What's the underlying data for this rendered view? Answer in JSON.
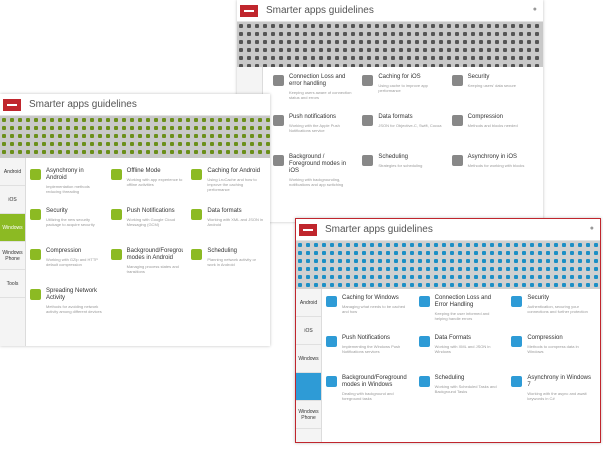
{
  "colors": {
    "brand": "#c0262d",
    "android": "#8cba23",
    "windows": "#2e9bd6",
    "ios": "#888888"
  },
  "windows": {
    "ios": {
      "title": "Smarter apps guidelines",
      "sidebar": [
        "",
        "",
        "",
        "",
        ""
      ],
      "cards": [
        {
          "title": "Connection Loss and error handling",
          "desc": "Keeping users aware of connection status and errors",
          "icon": "warning-icon"
        },
        {
          "title": "Caching for iOS",
          "desc": "Using cache to improve app performance",
          "icon": "cache-icon"
        },
        {
          "title": "Security",
          "desc": "Keeping users' data secure",
          "icon": "lock-icon"
        },
        {
          "title": "Push notifications",
          "desc": "Working with the Apple Push Notifications service",
          "icon": "bell-icon"
        },
        {
          "title": "Data formats",
          "desc": "JSON for Objective-C, Swift, Cocoa",
          "icon": "data-icon"
        },
        {
          "title": "Compression",
          "desc": "Methods and blocks needed",
          "icon": "compress-icon"
        },
        {
          "title": "Background / Foreground modes in iOS",
          "desc": "Working with backgrounding, notifications and app switching",
          "icon": "layers-icon"
        },
        {
          "title": "Scheduling",
          "desc": "Strategies for scheduling",
          "icon": "calendar-icon"
        },
        {
          "title": "Asynchrony in iOS",
          "desc": "Methods for working with blocks",
          "icon": "async-icon"
        }
      ],
      "footer_left": "",
      "footer_right": ""
    },
    "android": {
      "title": "Smarter apps guidelines",
      "hero_label": "",
      "sidebar": [
        "Android",
        "iOS",
        "Windows",
        "Windows\nPhone",
        "Tools"
      ],
      "cards": [
        {
          "title": "Asynchrony in Android",
          "desc": "Implementation methods reducing threading",
          "icon": "async-icon"
        },
        {
          "title": "Offline Mode",
          "desc": "Working with app experience to offline activities",
          "icon": "offline-icon"
        },
        {
          "title": "Caching for Android",
          "desc": "Using LruCache and how to improve the caching performance",
          "icon": "cache-icon"
        },
        {
          "title": "Security",
          "desc": "Utilizing the new security package to acquire security",
          "icon": "lock-icon"
        },
        {
          "title": "Push Notifications",
          "desc": "Working with Google Cloud Messaging (GCM)",
          "icon": "bell-icon"
        },
        {
          "title": "Data formats",
          "desc": "Working with XML and JSON in Android",
          "icon": "data-icon"
        },
        {
          "title": "Compression",
          "desc": "Working with GZip and HTTP default compression",
          "icon": "compress-icon"
        },
        {
          "title": "Background/Foreground modes in Android",
          "desc": "Managing process states and transitions",
          "icon": "layers-icon"
        },
        {
          "title": "Scheduling",
          "desc": "Planning network activity or work in Android",
          "icon": "calendar-icon"
        },
        {
          "title": "Spreading Network Activity",
          "desc": "Methods for avoiding network activity among different devices",
          "icon": "network-icon"
        }
      ],
      "footer_left": "",
      "footer_right": ""
    },
    "windows": {
      "title": "Smarter apps guidelines",
      "sidebar": [
        "Android",
        "iOS",
        "Windows",
        "",
        "Windows\nPhone"
      ],
      "cards": [
        {
          "title": "Caching for Windows",
          "desc": "Managing what needs to be cached and how",
          "icon": "cache-icon"
        },
        {
          "title": "Connection Loss and Error Handling",
          "desc": "Keeping the user informed and helping handle errors",
          "icon": "warning-icon"
        },
        {
          "title": "Security",
          "desc": "Authentication, securing your connections and further protection",
          "icon": "lock-icon"
        },
        {
          "title": "Push Notifications",
          "desc": "Implementing the Windows Push Notifications services",
          "icon": "bell-icon"
        },
        {
          "title": "Data Formats",
          "desc": "Working with XML and JSON in Windows",
          "icon": "data-icon"
        },
        {
          "title": "Compression",
          "desc": "Methods to compress data in Windows",
          "icon": "compress-icon"
        },
        {
          "title": "Background/Foreground modes in Windows",
          "desc": "Dealing with background and foreground tasks",
          "icon": "layers-icon"
        },
        {
          "title": "Scheduling",
          "desc": "Working with Scheduled Tasks and Background Tasks",
          "icon": "calendar-icon"
        },
        {
          "title": "Asynchrony in Windows 7",
          "desc": "Working with the async and await keywords in C#",
          "icon": "async-icon"
        }
      ],
      "footer_left": "",
      "footer_right": ""
    }
  }
}
